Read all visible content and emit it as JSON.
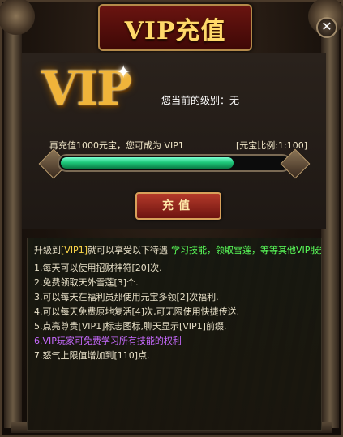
{
  "window": {
    "title": "VIP充值",
    "close_glyph": "✕"
  },
  "logo": {
    "text": "VIP",
    "sparkle": "✦"
  },
  "status": {
    "current_level": "您当前的级别：无",
    "recharge_hint": "再充值1000元宝，您可成为 VIP1",
    "ratio": "[元宝比例:1:100]",
    "progress": 0.76
  },
  "actions": {
    "recharge_label": "充值"
  },
  "benefits": {
    "head_pre": "升级到",
    "head_vip": "[VIP1]",
    "head_post": "就可以享受以下待遇",
    "head_link": "学习技能，领取雪莲，等等其他VIP服务",
    "items": [
      "1.每天可以使用招财神符[20]次.",
      "2.免费领取天外雪莲[3]个.",
      "3.可以每天在福利员那使用元宝多领[2]次福利.",
      "4.可以每天免费原地复活[4]次,可无限使用快捷传送.",
      "5.点亮尊贵[VIP1]标志图标,聊天显示[VIP1]前缀.",
      "6.VIP玩家可免费学习所有技能的权利",
      "7.怒气上限值增加到[110]点."
    ]
  },
  "colors": {
    "accent_gold": "#ffd96a",
    "progress_green": "#1ec87a",
    "link_green": "#5aff5a",
    "highlight_purple": "#c86aff"
  }
}
